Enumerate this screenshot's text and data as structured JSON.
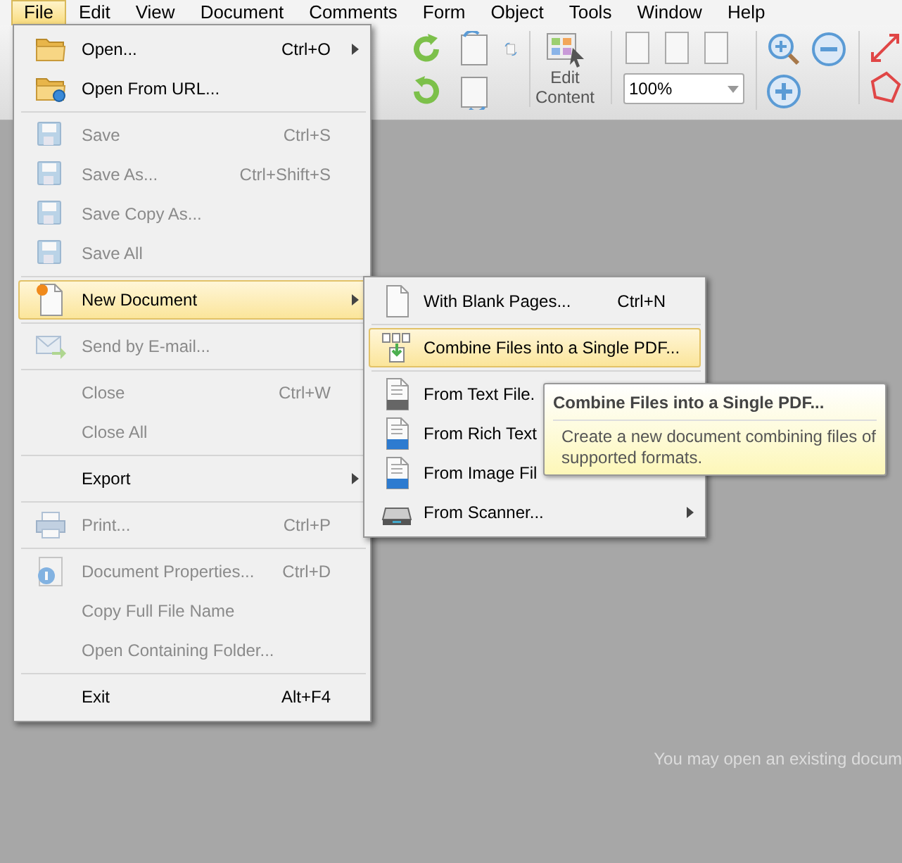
{
  "menubar": [
    {
      "label": "File",
      "selected": true
    },
    {
      "label": "Edit",
      "selected": false
    },
    {
      "label": "View",
      "selected": false
    },
    {
      "label": "Document",
      "selected": false
    },
    {
      "label": "Comments",
      "selected": false
    },
    {
      "label": "Form",
      "selected": false
    },
    {
      "label": "Object",
      "selected": false
    },
    {
      "label": "Tools",
      "selected": false
    },
    {
      "label": "Window",
      "selected": false
    },
    {
      "label": "Help",
      "selected": false
    }
  ],
  "toolbar": {
    "edit_content": "Edit Content",
    "zoom": "100%"
  },
  "file_menu": [
    {
      "kind": "item",
      "label": "Open...",
      "shortcut": "Ctrl+O",
      "submenu": true,
      "disabled": false,
      "selected": false
    },
    {
      "kind": "item",
      "label": "Open From URL...",
      "disabled": false,
      "selected": false
    },
    {
      "kind": "separator"
    },
    {
      "kind": "item",
      "label": "Save",
      "shortcut": "Ctrl+S",
      "disabled": true,
      "selected": false
    },
    {
      "kind": "item",
      "label": "Save As...",
      "shortcut": "Ctrl+Shift+S",
      "disabled": true,
      "selected": false
    },
    {
      "kind": "item",
      "label": "Save Copy As...",
      "disabled": true,
      "selected": false
    },
    {
      "kind": "item",
      "label": "Save All",
      "disabled": true,
      "selected": false
    },
    {
      "kind": "separator"
    },
    {
      "kind": "item",
      "label": "New Document",
      "submenu": true,
      "disabled": false,
      "selected": true
    },
    {
      "kind": "separator"
    },
    {
      "kind": "item",
      "label": "Send by E-mail...",
      "disabled": true,
      "selected": false
    },
    {
      "kind": "separator"
    },
    {
      "kind": "item",
      "label": "Close",
      "shortcut": "Ctrl+W",
      "disabled": true,
      "selected": false
    },
    {
      "kind": "item",
      "label": "Close All",
      "disabled": true,
      "selected": false
    },
    {
      "kind": "separator"
    },
    {
      "kind": "item",
      "label": "Export",
      "submenu": true,
      "disabled": false,
      "selected": false
    },
    {
      "kind": "separator"
    },
    {
      "kind": "item",
      "label": "Print...",
      "shortcut": "Ctrl+P",
      "disabled": true,
      "selected": false
    },
    {
      "kind": "separator"
    },
    {
      "kind": "item",
      "label": "Document Properties...",
      "shortcut": "Ctrl+D",
      "disabled": true,
      "selected": false
    },
    {
      "kind": "item",
      "label": "Copy Full File Name",
      "disabled": true,
      "selected": false
    },
    {
      "kind": "item",
      "label": "Open Containing Folder...",
      "disabled": true,
      "selected": false
    },
    {
      "kind": "separator"
    },
    {
      "kind": "item",
      "label": "Exit",
      "shortcut": "Alt+F4",
      "disabled": false,
      "selected": false
    }
  ],
  "new_document_menu": [
    {
      "kind": "item",
      "label": "With Blank Pages...",
      "shortcut": "Ctrl+N",
      "selected": false
    },
    {
      "kind": "separator"
    },
    {
      "kind": "item",
      "label": "Combine Files into a Single PDF...",
      "selected": true
    },
    {
      "kind": "separator"
    },
    {
      "kind": "item",
      "label": "From Text File.",
      "selected": false
    },
    {
      "kind": "item",
      "label": "From Rich Text",
      "selected": false
    },
    {
      "kind": "item",
      "label": "From Image Fil",
      "selected": false
    },
    {
      "kind": "item",
      "label": "From Scanner...",
      "submenu": true,
      "selected": false
    }
  ],
  "tooltip": {
    "title": "Combine Files into a Single PDF...",
    "text": "Create a new document combining files of supported formats."
  },
  "empty_message": "You may open an existing docum"
}
